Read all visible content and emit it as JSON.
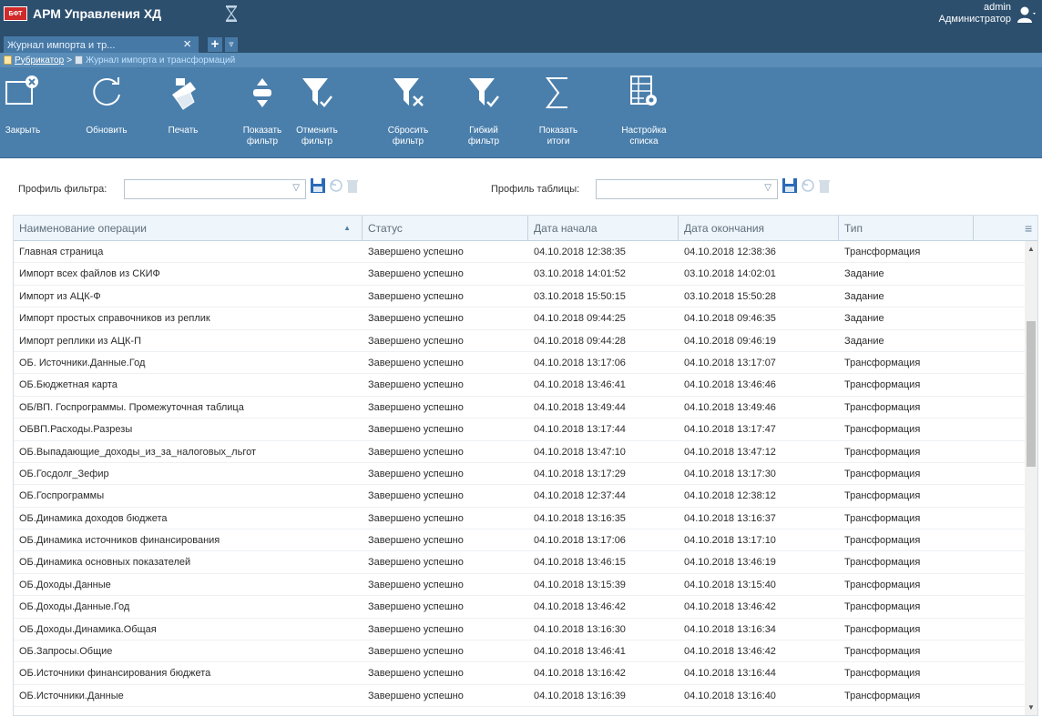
{
  "header": {
    "logo_badge": "БФТ",
    "app_title": "АРМ Управления ХД",
    "user_name": "admin",
    "user_role": "Администратор"
  },
  "tabs": [
    {
      "label": "Журнал импорта и тр..."
    }
  ],
  "breadcrumb": {
    "root": "Рубрикатор",
    "separator": ">",
    "current": "Журнал импорта и трансформаций"
  },
  "toolbar": {
    "close": "Закрыть",
    "refresh": "Обновить",
    "print": "Печать",
    "show_filter": "Показать\nфильтр",
    "cancel_filter": "Отменить\nфильтр",
    "reset_filter": "Сбросить\nфильтр",
    "flex_filter": "Гибкий\nфильтр",
    "show_totals": "Показать\nитоги",
    "list_settings": "Настройка\nсписка"
  },
  "filters": {
    "filter_profile_label": "Профиль фильтра:",
    "filter_profile_value": "",
    "table_profile_label": "Профиль таблицы:",
    "table_profile_value": ""
  },
  "grid": {
    "columns": [
      "Наименование операции",
      "Статус",
      "Дата начала",
      "Дата окончания",
      "Тип"
    ],
    "rows": [
      [
        "Главная страница",
        "Завершено успешно",
        "04.10.2018 12:38:35",
        "04.10.2018 12:38:36",
        "Трансформация"
      ],
      [
        "Импорт всех файлов из СКИФ",
        "Завершено успешно",
        "03.10.2018 14:01:52",
        "03.10.2018 14:02:01",
        "Задание"
      ],
      [
        "Импорт из АЦК-Ф",
        "Завершено успешно",
        "03.10.2018 15:50:15",
        "03.10.2018 15:50:28",
        "Задание"
      ],
      [
        "Импорт простых справочников из реплик",
        "Завершено успешно",
        "04.10.2018 09:44:25",
        "04.10.2018 09:46:35",
        "Задание"
      ],
      [
        "Импорт реплики из АЦК-П",
        "Завершено успешно",
        "04.10.2018 09:44:28",
        "04.10.2018 09:46:19",
        "Задание"
      ],
      [
        "ОБ. Источники.Данные.Год",
        "Завершено успешно",
        "04.10.2018 13:17:06",
        "04.10.2018 13:17:07",
        "Трансформация"
      ],
      [
        "ОБ.Бюджетная карта",
        "Завершено успешно",
        "04.10.2018 13:46:41",
        "04.10.2018 13:46:46",
        "Трансформация"
      ],
      [
        "ОБ/ВП. Госпрограммы. Промежуточная таблица",
        "Завершено успешно",
        "04.10.2018 13:49:44",
        "04.10.2018 13:49:46",
        "Трансформация"
      ],
      [
        "ОБВП.Расходы.Разрезы",
        "Завершено успешно",
        "04.10.2018 13:17:44",
        "04.10.2018 13:17:47",
        "Трансформация"
      ],
      [
        "ОБ.Выпадающие_доходы_из_за_налоговых_льгот",
        "Завершено успешно",
        "04.10.2018 13:47:10",
        "04.10.2018 13:47:12",
        "Трансформация"
      ],
      [
        "ОБ.Госдолг_Зефир",
        "Завершено успешно",
        "04.10.2018 13:17:29",
        "04.10.2018 13:17:30",
        "Трансформация"
      ],
      [
        "ОБ.Госпрограммы",
        "Завершено успешно",
        "04.10.2018 12:37:44",
        "04.10.2018 12:38:12",
        "Трансформация"
      ],
      [
        "ОБ.Динамика доходов бюджета",
        "Завершено успешно",
        "04.10.2018 13:16:35",
        "04.10.2018 13:16:37",
        "Трансформация"
      ],
      [
        "ОБ.Динамика источников финансирования",
        "Завершено успешно",
        "04.10.2018 13:17:06",
        "04.10.2018 13:17:10",
        "Трансформация"
      ],
      [
        "ОБ.Динамика основных показателей",
        "Завершено успешно",
        "04.10.2018 13:46:15",
        "04.10.2018 13:46:19",
        "Трансформация"
      ],
      [
        "ОБ.Доходы.Данные",
        "Завершено успешно",
        "04.10.2018 13:15:39",
        "04.10.2018 13:15:40",
        "Трансформация"
      ],
      [
        "ОБ.Доходы.Данные.Год",
        "Завершено успешно",
        "04.10.2018 13:46:42",
        "04.10.2018 13:46:42",
        "Трансформация"
      ],
      [
        "ОБ.Доходы.Динамика.Общая",
        "Завершено успешно",
        "04.10.2018 13:16:30",
        "04.10.2018 13:16:34",
        "Трансформация"
      ],
      [
        "ОБ.Запросы.Общие",
        "Завершено успешно",
        "04.10.2018 13:46:41",
        "04.10.2018 13:46:42",
        "Трансформация"
      ],
      [
        "ОБ.Источники финансирования бюджета",
        "Завершено успешно",
        "04.10.2018 13:16:42",
        "04.10.2018 13:16:44",
        "Трансформация"
      ],
      [
        "ОБ.Источники.Данные",
        "Завершено успешно",
        "04.10.2018 13:16:39",
        "04.10.2018 13:16:40",
        "Трансформация"
      ]
    ]
  },
  "colors": {
    "header_bg": "#2c4f6e",
    "toolbar_bg": "#4a7fac",
    "tab_bg": "#4779a6",
    "grid_header_bg": "#eef5fb",
    "save_icon": "#2a6ab8"
  }
}
